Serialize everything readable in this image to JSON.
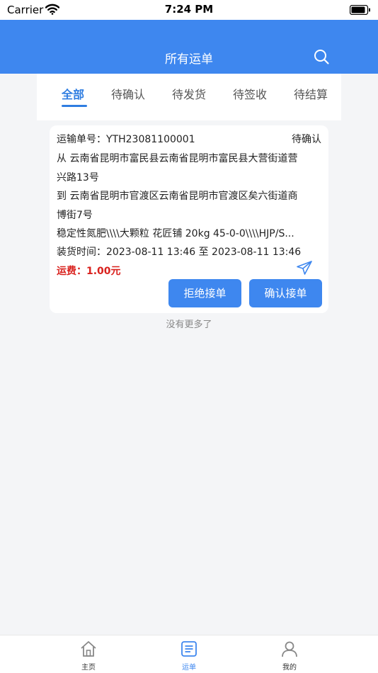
{
  "status_bar": {
    "carrier": "Carrier",
    "time": "7:24 PM"
  },
  "header": {
    "title": "所有运单",
    "search_icon": "search-icon"
  },
  "tabs": [
    {
      "label": "全部",
      "active": true
    },
    {
      "label": "待确认",
      "active": false
    },
    {
      "label": "待发货",
      "active": false
    },
    {
      "label": "待签收",
      "active": false
    },
    {
      "label": "待结算",
      "active": false
    }
  ],
  "order": {
    "order_no": "运输单号：YTH23081100001",
    "status": "待确认",
    "from_line1": "从 云南省昆明市富民县云南省昆明市富民县大营街道营",
    "from_line2": "兴路13号",
    "to_line1": "到 云南省昆明市官渡区云南省昆明市官渡区矣六街道商",
    "to_line2": "博街7号",
    "goods": "稳定性氮肥\\\\\\\\大颗粒 花匠铺 20kg 45-0-0\\\\\\\\HJP/S...",
    "loading_time": "装货时间：2023-08-11 13:46 至 2023-08-11 13:46",
    "fee": "运费：1.00元",
    "reject_label": "拒绝接单",
    "confirm_label": "确认接单",
    "fee_color": "#d9211d"
  },
  "footer_note": "没有更多了",
  "tabbar": [
    {
      "label": "主页",
      "icon": "home-icon",
      "active": false
    },
    {
      "label": "运单",
      "icon": "document-list-icon",
      "active": true
    },
    {
      "label": "我的",
      "icon": "user-icon",
      "active": false
    }
  ],
  "colors": {
    "brand": "#3e87ef",
    "active_tab": "#2f7de1"
  }
}
